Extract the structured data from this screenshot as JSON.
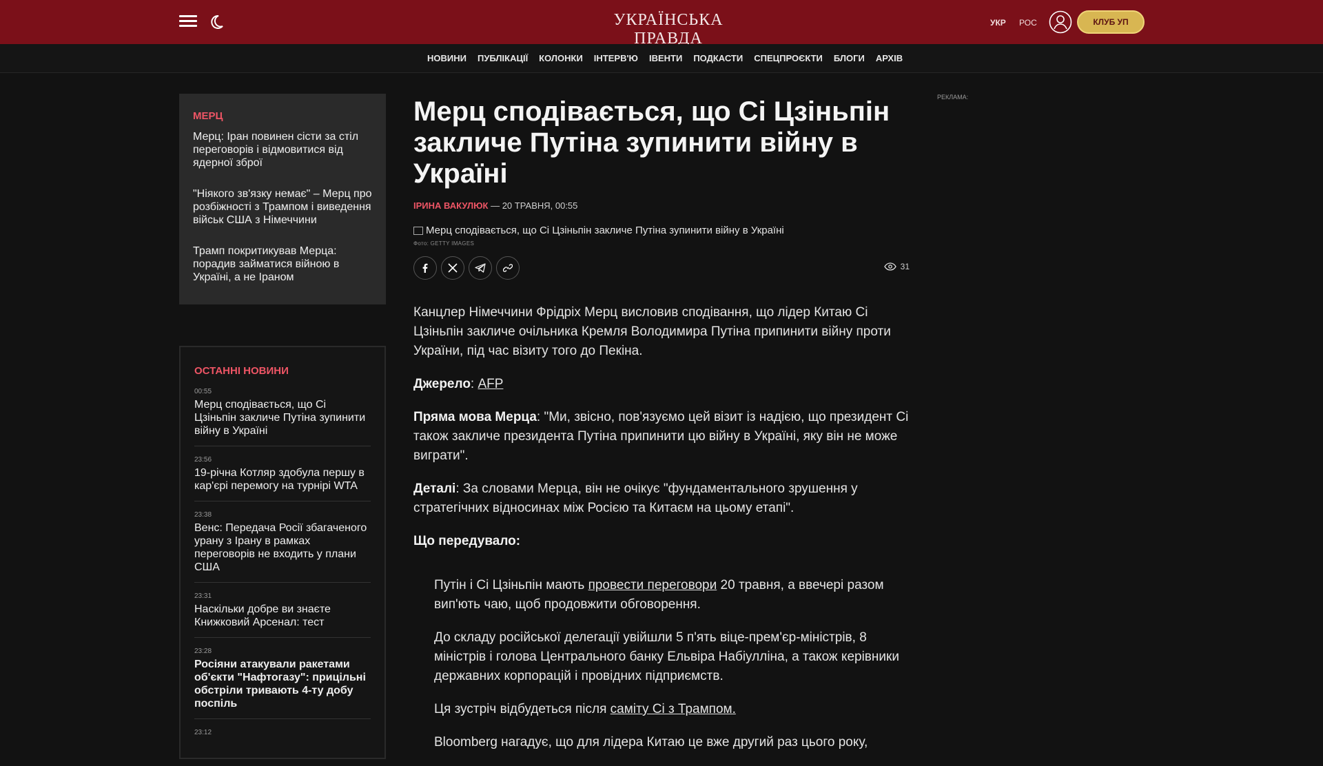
{
  "header": {
    "logo": "УКРАЇНСЬКА ПРАВДА",
    "lang_ukr": "УКР",
    "lang_ros": "РОС",
    "club_button": "КЛУБ УП"
  },
  "nav": {
    "items": [
      "НОВИНИ",
      "ПУБЛІКАЦІЇ",
      "КОЛОНКИ",
      "ІНТЕРВ'Ю",
      "ІВЕНТИ",
      "ПОДКАСТИ",
      "СПЕЦПРОЄКТИ",
      "БЛОГИ",
      "АРХІВ"
    ]
  },
  "related": {
    "tag": "МЕРЦ",
    "items": [
      "Мерц: Іран повинен сісти за стіл переговорів і відмовитися від ядерної зброї",
      "\"Ніякого зв'язку немає\" – Мерц про розбіжності з Трампом і виведення військ США з Німеччини",
      "Трамп покритикував Мерца: порадив займатися війною в Україні, а не Іраном"
    ]
  },
  "latest": {
    "heading": "ОСТАННІ НОВИНИ",
    "items": [
      {
        "time": "00:55",
        "title": "Мерц сподівається, що Сі Цзіньпін закличе Путіна зупинити війну в Україні",
        "bold": false
      },
      {
        "time": "23:56",
        "title": "19-річна Котляр здобула першу в кар'єрі перемогу на турнірі WTA",
        "bold": false
      },
      {
        "time": "23:38",
        "title": "Венс: Передача Росії збагаченого урану з Ірану в рамках переговорів не входить у плани США",
        "bold": false
      },
      {
        "time": "23:31",
        "title": "Наскільки добре ви знаєте Книжковий Арсенал: тест",
        "bold": false
      },
      {
        "time": "23:28",
        "title": "Росіяни атакували ракетами об'єкти \"Нафтогазу\": прицільні обстріли тривають 4-ту добу поспіль",
        "bold": true
      },
      {
        "time": "23:12",
        "title": "",
        "bold": false
      }
    ]
  },
  "article": {
    "title": "Мерц сподівається, що Сі Цзіньпін закличе Путіна зупинити війну в Україні",
    "author": "ІРИНА ВАКУЛЮК",
    "date": "— 20 ТРАВНЯ, 00:55",
    "photo_alt": "Мерц сподівається, що Сі Цзіньпін закличе Путіна зупинити війну в Україні",
    "photo_credit": "Фото: GETTY IMAGES",
    "views": "31",
    "lead": "Канцлер Німеччини Фрідріх Мерц висловив сподівання, що лідер Китаю Сі Цзіньпін закличе очільника Кремля Володимира Путіна припинити війну проти України, під час візиту того до Пекіна.",
    "source_label": "Джерело",
    "source_link": "AFP",
    "quote_label": "Пряма мова Мерца",
    "quote_text": ": \"Ми, звісно, пов'язуємо цей візит із надією, що президент Сі також закличе президента Путіна припинити цю війну в Україні, яку він не може виграти\".",
    "details_label": "Деталі",
    "details_text": ": За словами Мерца, він не очікує \"фундаментального зрушення у стратегічних відносинах між Росією та Китаєм на цьому етапі\".",
    "background_label": "Що передувало:",
    "bg1_pre": "Путін і Сі Цзіньпін мають ",
    "bg1_link": "провести переговори",
    "bg1_post": " 20 травня, а ввечері разом вип'ють чаю, щоб продовжити обговорення.",
    "bg2": "До складу російської делегації увійшли 5 п'ять віце-прем'єр-міністрів, 8 міністрів і голова Центрального банку Ельвіра Набіулліна, а також керівники державних корпорацій і провідних підприємств.",
    "bg3_pre": "Ця зустріч відбудеться після ",
    "bg3_link": "саміту Сі з Трампом.",
    "bg4": "Bloomberg нагадує, що для лідера Китаю це вже другий раз цього року,"
  },
  "ad": {
    "label": "РЕКЛАМА:"
  }
}
